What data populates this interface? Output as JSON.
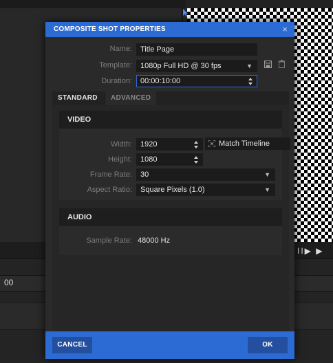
{
  "background": {
    "time_label": "00",
    "transport_label": "II▶ ▶"
  },
  "dialog": {
    "title": "COMPOSITE SHOT PROPERTIES",
    "close_glyph": "×",
    "name": {
      "label": "Name:",
      "value": "Title Page"
    },
    "template": {
      "label": "Template:",
      "value": "1080p Full HD @ 30 fps"
    },
    "duration": {
      "label": "Duration:",
      "value": "00:00:10:00"
    },
    "tabs": [
      {
        "label": "STANDARD",
        "active": true
      },
      {
        "label": "ADVANCED",
        "active": false
      }
    ],
    "video": {
      "heading": "VIDEO",
      "width": {
        "label": "Width:",
        "value": "1920"
      },
      "height": {
        "label": "Height:",
        "value": "1080"
      },
      "match_timeline_label": "Match Timeline",
      "frame_rate": {
        "label": "Frame Rate:",
        "value": "30"
      },
      "aspect_ratio": {
        "label": "Aspect Ratio:",
        "value": "Square Pixels (1.0)"
      }
    },
    "audio": {
      "heading": "AUDIO",
      "sample_rate": {
        "label": "Sample Rate:",
        "value": "48000 Hz"
      }
    },
    "cancel_label": "CANCEL",
    "ok_label": "OK"
  },
  "colors": {
    "accent": "#2d6bd4",
    "dialog_bg": "#2a2a2a",
    "field_bg": "#1b1b1b"
  },
  "icons": [
    "close-icon",
    "chevron-down-icon",
    "save-icon",
    "trash-icon",
    "match-timeline-icon",
    "cursor-arrow-icon",
    "play-icon"
  ]
}
